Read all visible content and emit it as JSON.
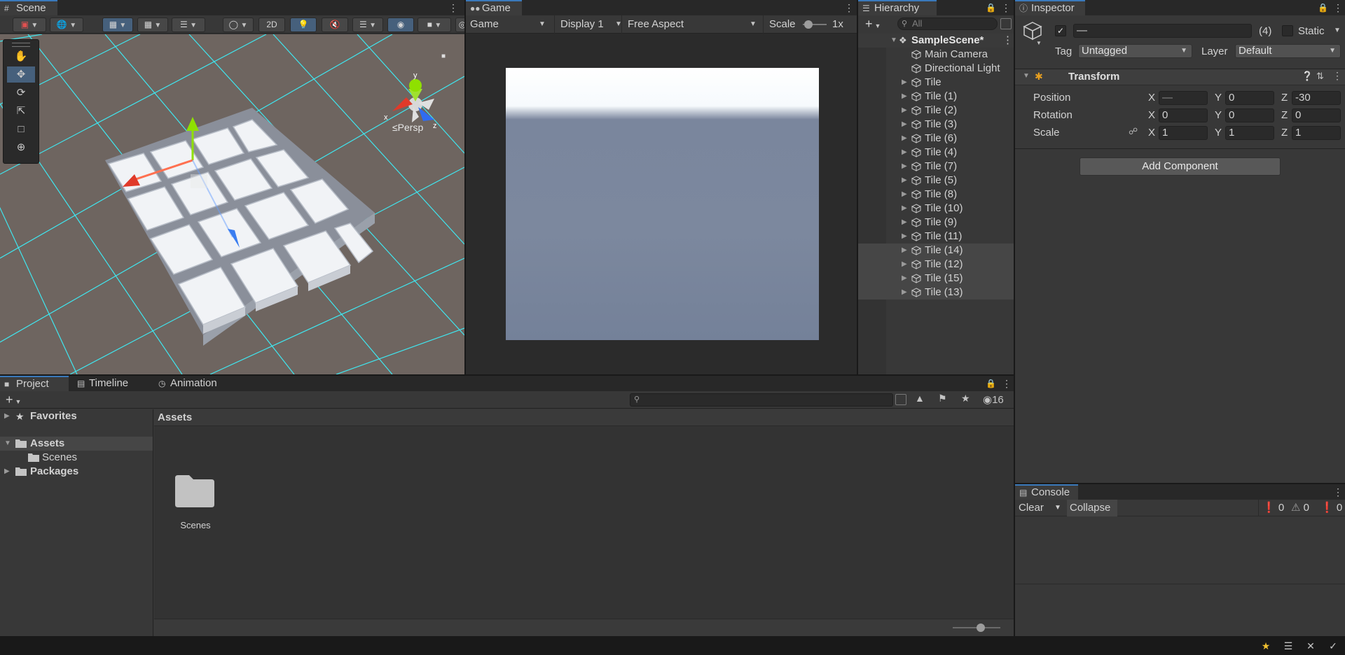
{
  "scene": {
    "tab_label": "Scene",
    "btn_2d": "2D",
    "persp_label": "≤Persp",
    "gizmo_axis_x": "x",
    "gizmo_axis_y": "y",
    "gizmo_axis_z": "z"
  },
  "game": {
    "tab_label": "Game",
    "mode_label": "Game",
    "display_label": "Display 1",
    "aspect_label": "Free Aspect",
    "scale_label": "Scale",
    "scale_value": "1x",
    "sky_color": "#ffffff",
    "ground_color": "#7a869d"
  },
  "hierarchy": {
    "tab_label": "Hierarchy",
    "search_placeholder": "All",
    "scene_name": "SampleScene*",
    "items": [
      {
        "label": "Main Camera",
        "expandable": false,
        "selected": false
      },
      {
        "label": "Directional Light",
        "expandable": false,
        "selected": false
      },
      {
        "label": "Tile",
        "expandable": true,
        "selected": false
      },
      {
        "label": "Tile (1)",
        "expandable": true,
        "selected": false
      },
      {
        "label": "Tile (2)",
        "expandable": true,
        "selected": false
      },
      {
        "label": "Tile (3)",
        "expandable": true,
        "selected": false
      },
      {
        "label": "Tile (6)",
        "expandable": true,
        "selected": false
      },
      {
        "label": "Tile (4)",
        "expandable": true,
        "selected": false
      },
      {
        "label": "Tile (7)",
        "expandable": true,
        "selected": false
      },
      {
        "label": "Tile (5)",
        "expandable": true,
        "selected": false
      },
      {
        "label": "Tile (8)",
        "expandable": true,
        "selected": false
      },
      {
        "label": "Tile (10)",
        "expandable": true,
        "selected": false
      },
      {
        "label": "Tile (9)",
        "expandable": true,
        "selected": false
      },
      {
        "label": "Tile (11)",
        "expandable": true,
        "selected": false
      },
      {
        "label": "Tile (14)",
        "expandable": true,
        "selected": true
      },
      {
        "label": "Tile (12)",
        "expandable": true,
        "selected": true
      },
      {
        "label": "Tile (15)",
        "expandable": true,
        "selected": true
      },
      {
        "label": "Tile (13)",
        "expandable": true,
        "selected": true
      }
    ]
  },
  "inspector": {
    "tab_label": "Inspector",
    "name_value": "—",
    "count_label": "(4)",
    "static_label": "Static",
    "tag_label": "Tag",
    "tag_value": "Untagged",
    "layer_label": "Layer",
    "layer_value": "Default",
    "transform_title": "Transform",
    "position_label": "Position",
    "rotation_label": "Rotation",
    "scale_label": "Scale",
    "axis_x": "X",
    "axis_y": "Y",
    "axis_z": "Z",
    "position": {
      "x": "—",
      "y": "0",
      "z": "-30"
    },
    "rotation": {
      "x": "0",
      "y": "0",
      "z": "0"
    },
    "scale": {
      "x": "1",
      "y": "1",
      "z": "1"
    },
    "add_component_label": "Add Component"
  },
  "console": {
    "tab_label": "Console",
    "clear_label": "Clear",
    "collapse_label": "Collapse",
    "log_count": "0",
    "warning_count": "0",
    "error_count": "0"
  },
  "project": {
    "tabs": [
      "Project",
      "Timeline",
      "Animation"
    ],
    "hidden_count": "16",
    "tree": {
      "favorites": "Favorites",
      "assets": "Assets",
      "scenes": "Scenes",
      "packages": "Packages"
    },
    "breadcrumb": "Assets",
    "items": [
      {
        "label": "Scenes"
      }
    ]
  },
  "colors": {
    "selection_blue": "#3a79bb",
    "grid_cyan": "#3fe7f0",
    "scene_background": "#6e6560"
  }
}
